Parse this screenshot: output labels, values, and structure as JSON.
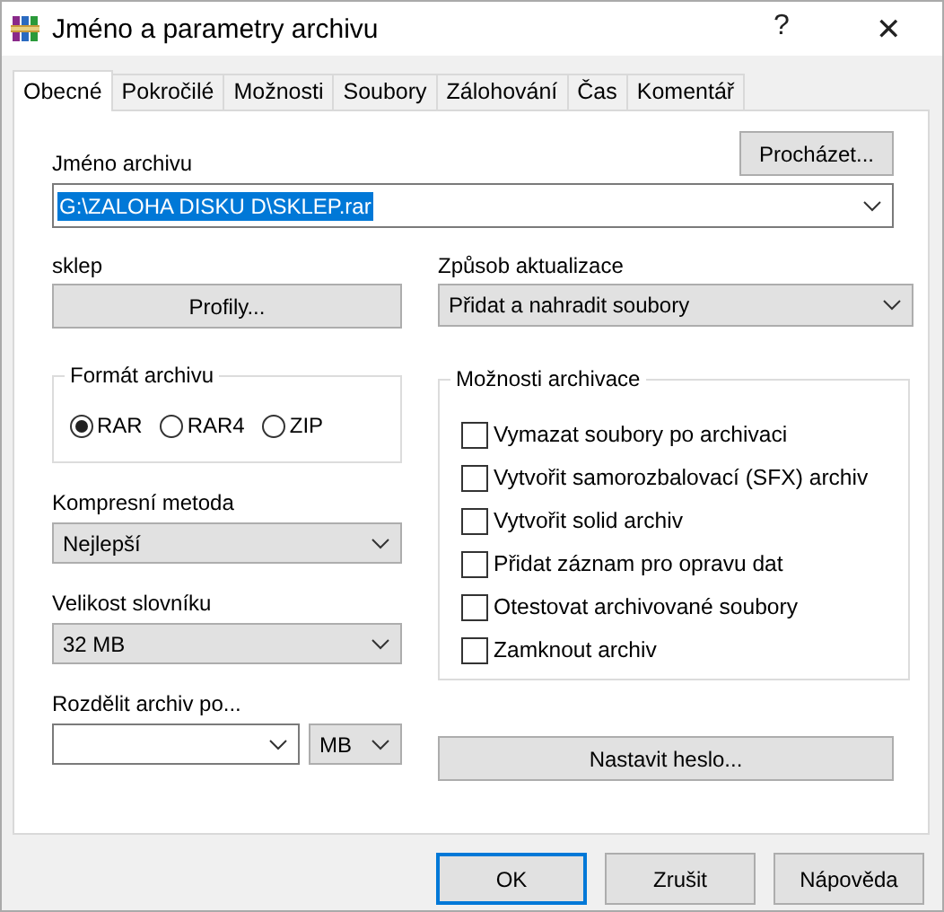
{
  "window": {
    "title": "Jméno a parametry archivu",
    "help": "?",
    "close": "✕"
  },
  "tabs": [
    {
      "label": "Obecné",
      "selected": true
    },
    {
      "label": "Pokročilé",
      "selected": false
    },
    {
      "label": "Možnosti",
      "selected": false
    },
    {
      "label": "Soubory",
      "selected": false
    },
    {
      "label": "Zálohování",
      "selected": false
    },
    {
      "label": "Čas",
      "selected": false
    },
    {
      "label": "Komentář",
      "selected": false
    }
  ],
  "archive_name": {
    "label": "Jméno archivu",
    "value": "G:\\ZALOHA DISKU D\\SKLEP.rar",
    "highlighted": true,
    "browse_button": "Procházet..."
  },
  "profile": {
    "label": "sklep",
    "button": "Profily..."
  },
  "update_mode": {
    "label": "Způsob aktualizace",
    "value": "Přidat a nahradit soubory",
    "editable": false
  },
  "format": {
    "label": "Formát archivu",
    "options": [
      {
        "label": "RAR",
        "selected": true
      },
      {
        "label": "RAR4",
        "selected": false
      },
      {
        "label": "ZIP",
        "selected": false
      }
    ]
  },
  "compression": {
    "label": "Kompresní metoda",
    "value": "Nejlepší",
    "editable": false
  },
  "dictionary": {
    "label": "Velikost slovníku",
    "value": "32 MB",
    "editable": false
  },
  "split": {
    "label": "Rozdělit archiv po...",
    "editable": true,
    "unit": "MB"
  },
  "options": {
    "label": "Možnosti archivace",
    "items": [
      {
        "label": "Vymazat soubory po archivaci",
        "checked": false
      },
      {
        "label": "Vytvořit samorozbalovací (SFX) archiv",
        "checked": false
      },
      {
        "label": "Vytvořit solid archiv",
        "checked": false
      },
      {
        "label": "Přidat záznam pro opravu dat",
        "checked": false
      },
      {
        "label": "Otestovat archivované soubory",
        "checked": false
      },
      {
        "label": "Zamknout archiv",
        "checked": false
      }
    ]
  },
  "password_button": "Nastavit heslo...",
  "buttons": [
    {
      "label": "OK",
      "default": true
    },
    {
      "label": "Zrušit",
      "default": false
    },
    {
      "label": "Nápověda",
      "default": false
    }
  ]
}
